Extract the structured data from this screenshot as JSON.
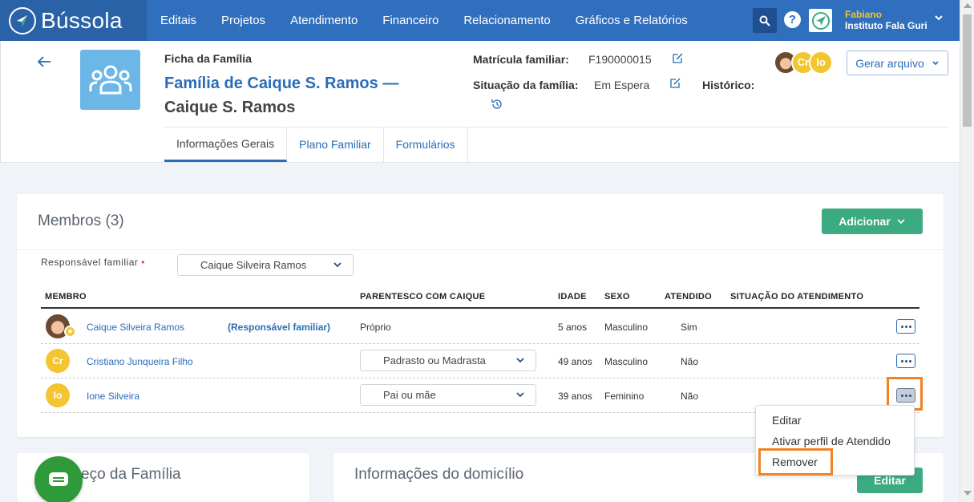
{
  "app": {
    "name": "Bússola"
  },
  "nav": {
    "items": [
      "Editais",
      "Projetos",
      "Atendimento",
      "Financeiro",
      "Relacionamento",
      "Gráficos e Relatórios"
    ]
  },
  "user": {
    "name": "Fabiano",
    "org": "Instituto Fala Guri"
  },
  "header": {
    "section_label": "Ficha da Família",
    "family_name": "Família de Caique S. Ramos",
    "dash": "—",
    "responsible": "Caique S. Ramos",
    "matricula_label": "Matrícula familiar:",
    "matricula_value": "F190000015",
    "situacao_label": "Situação da família:",
    "situacao_value": "Em Espera",
    "historico_label": "Histórico:",
    "avatars": [
      "Cr",
      "Io"
    ],
    "gerar_label": "Gerar arquivo"
  },
  "tabs": [
    "Informações Gerais",
    "Plano Familiar",
    "Formulários"
  ],
  "members": {
    "title": "Membros (3)",
    "add_label": "Adicionar",
    "responsavel_label": "Responsável familiar",
    "responsavel_required": "•",
    "responsavel_value": "Caique Silveira Ramos",
    "columns": [
      "MEMBRO",
      "PARENTESCO COM CAIQUE",
      "IDADE",
      "SEXO",
      "ATENDIDO",
      "SITUAÇÃO DO ATENDIMENTO"
    ],
    "rows": [
      {
        "initials": "",
        "name": "Caique Silveira Ramos",
        "tag": "(Responsável familiar)",
        "parentesco": "Próprio",
        "idade": "5 anos",
        "sexo": "Masculino",
        "atendido": "Sim",
        "situacao": ""
      },
      {
        "initials": "Cr",
        "name": "Cristiano Junqueira Filho",
        "tag": "",
        "parentesco": "Padrasto ou Madrasta",
        "idade": "49 anos",
        "sexo": "Masculino",
        "atendido": "Não",
        "situacao": ""
      },
      {
        "initials": "Io",
        "name": "Ione Silveira",
        "tag": "",
        "parentesco": "Pai ou mãe",
        "idade": "39 anos",
        "sexo": "Feminino",
        "atendido": "Não",
        "situacao": ""
      }
    ]
  },
  "context_menu": {
    "items": [
      "Editar",
      "Ativar perfil de Atendido",
      "Remover"
    ]
  },
  "address_card": {
    "title": "eço da Família"
  },
  "domicilio_card": {
    "title": "Informações do domicílio",
    "edit_label": "Editar"
  },
  "colors": {
    "nav": "#2f6fbd",
    "accent": "#2a6cb8",
    "success": "#3dab82",
    "highlight": "#f08324",
    "avatar": "#f3c531"
  },
  "icons": {
    "logo": "compass-icon",
    "search": "search-icon",
    "help": "help-icon",
    "back": "back-arrow-icon",
    "family": "family-group-icon",
    "edit": "edit-icon",
    "history": "history-icon",
    "more": "more-dots-icon",
    "chat": "chat-icon"
  }
}
